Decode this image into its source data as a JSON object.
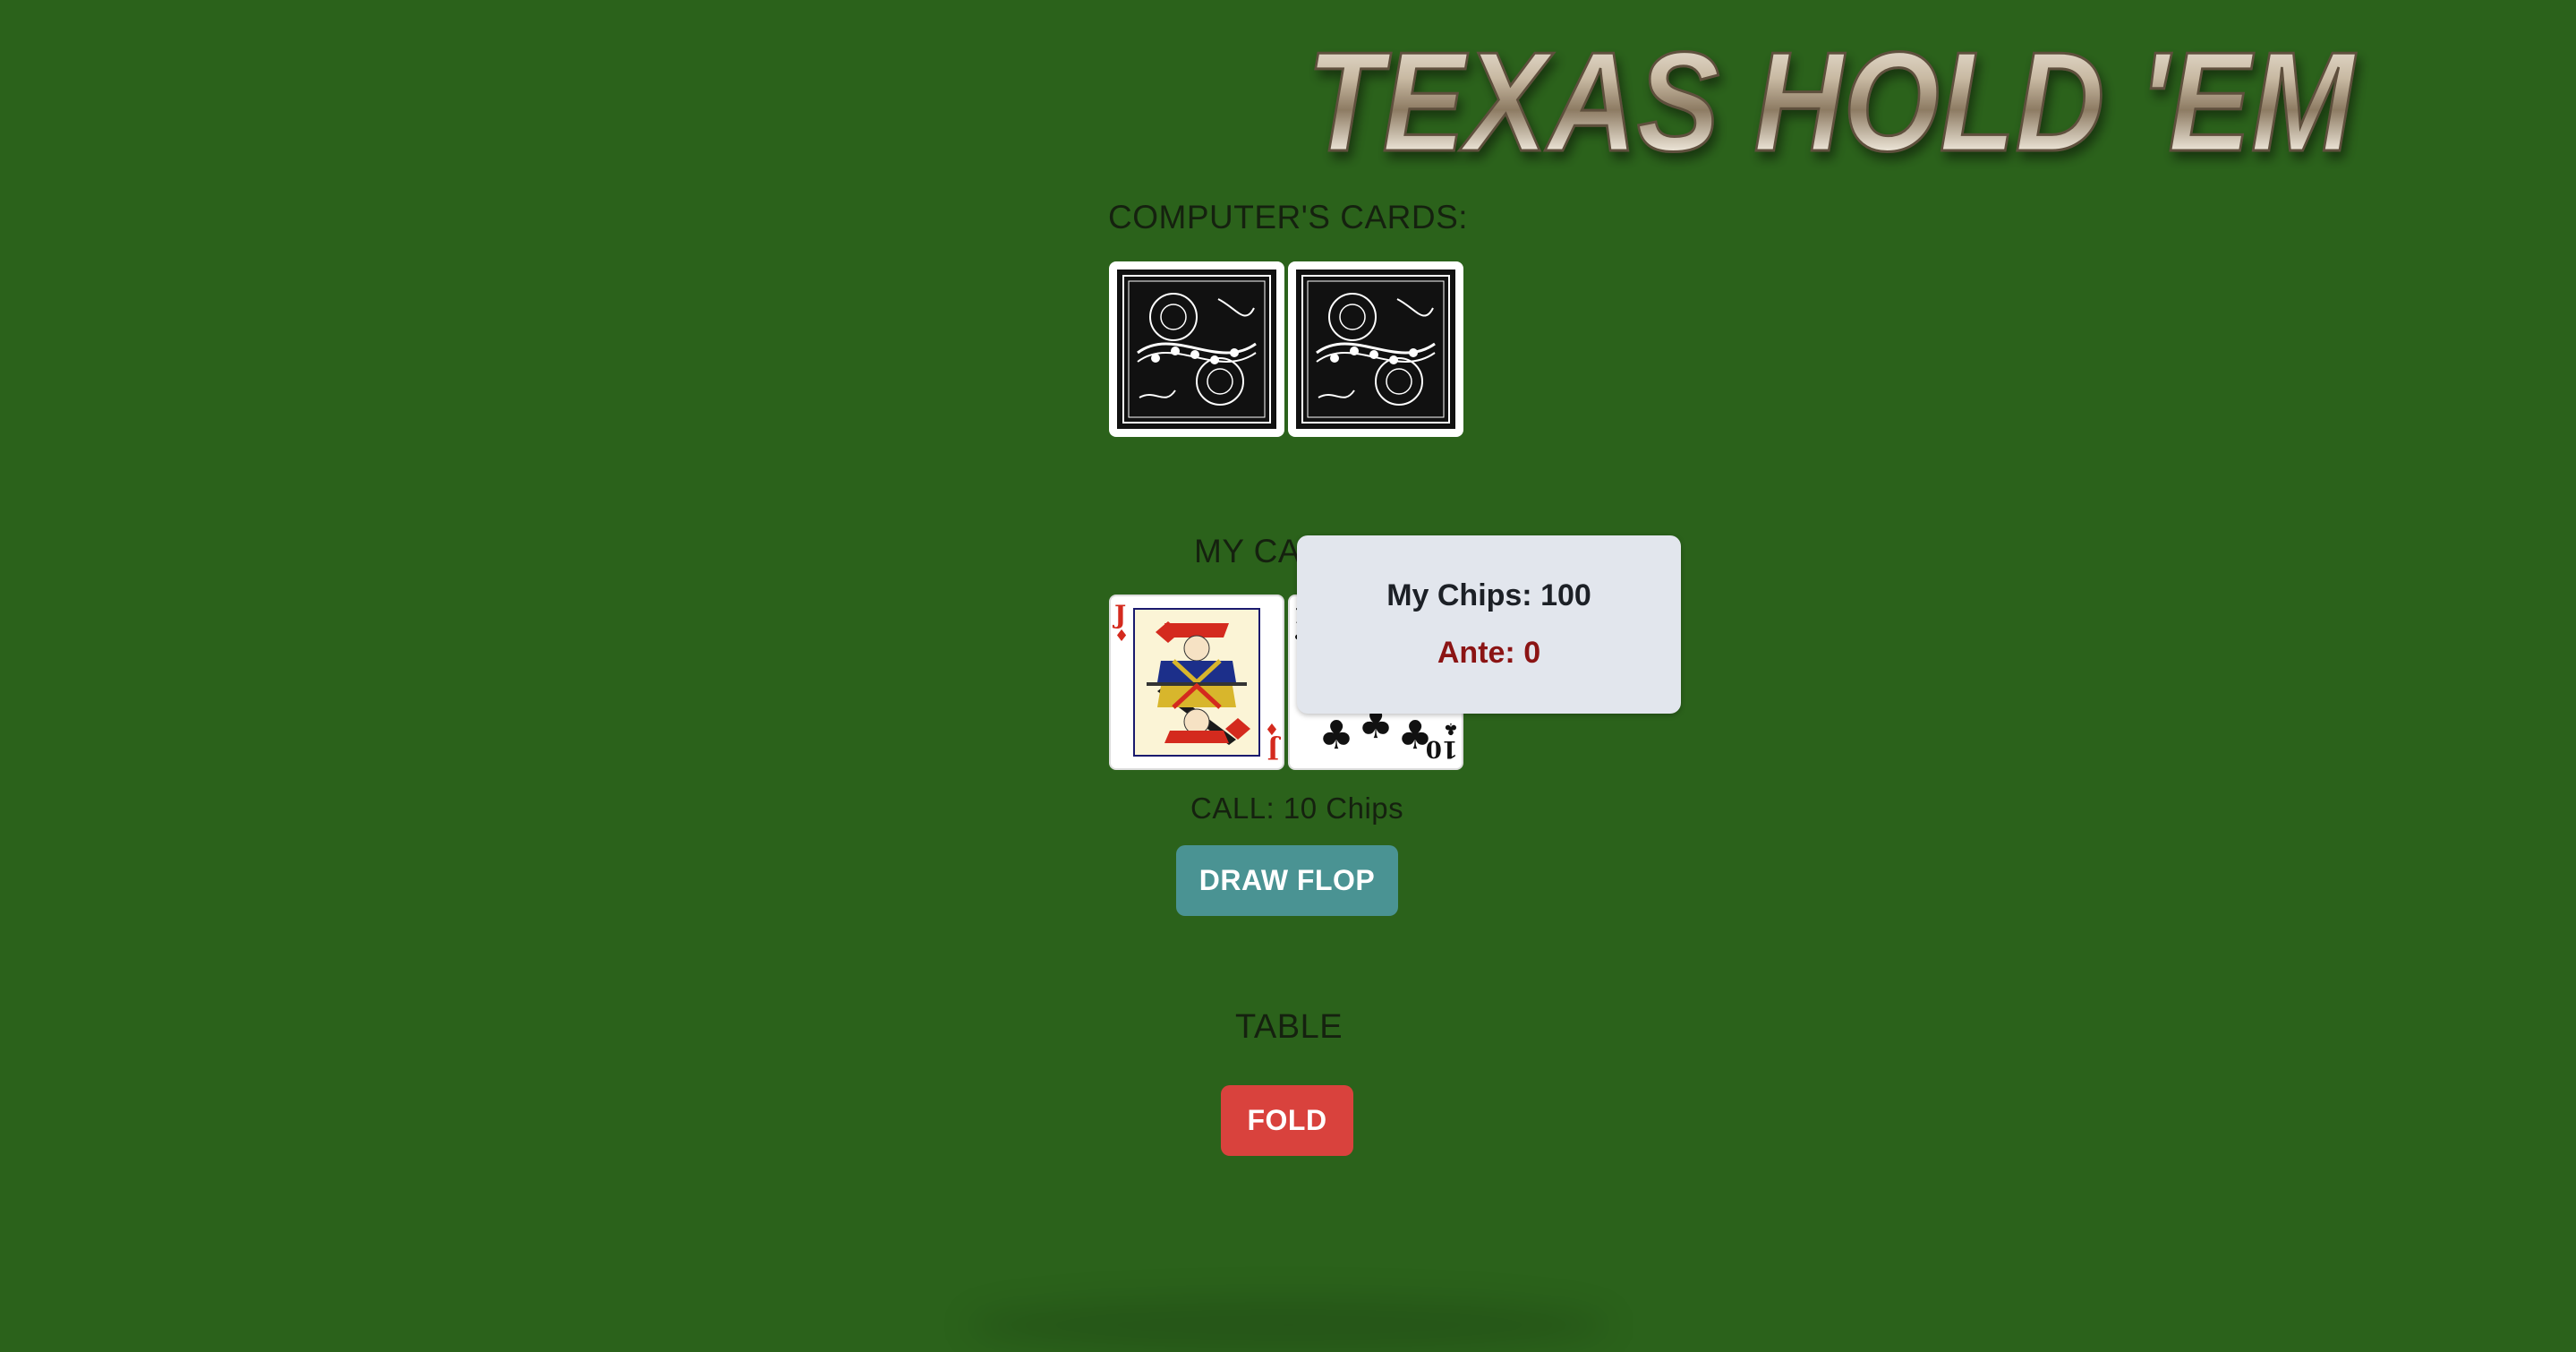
{
  "title": "TEXAS HOLD 'EM",
  "computer": {
    "label": "COMPUTER'S CARDS:",
    "cards": [
      "card-back",
      "card-back"
    ]
  },
  "player": {
    "label": "MY CA",
    "cards": [
      {
        "rank": "J",
        "suit": "♦",
        "color": "#d42a1e"
      },
      {
        "rank": "10",
        "suit": "♣",
        "color": "#111111"
      }
    ]
  },
  "popup": {
    "chips": "My Chips: 100",
    "ante": "Ante: 0"
  },
  "call_text": "CALL: 10 Chips",
  "draw_button": "DRAW FLOP",
  "table_label": "TABLE",
  "fold_button": "FOLD",
  "colors": {
    "background": "#2b621b",
    "draw_button": "#4a9393",
    "fold_button": "#d9423d",
    "ante_text": "#8b1414",
    "popup_bg": "#e2e6ed"
  }
}
